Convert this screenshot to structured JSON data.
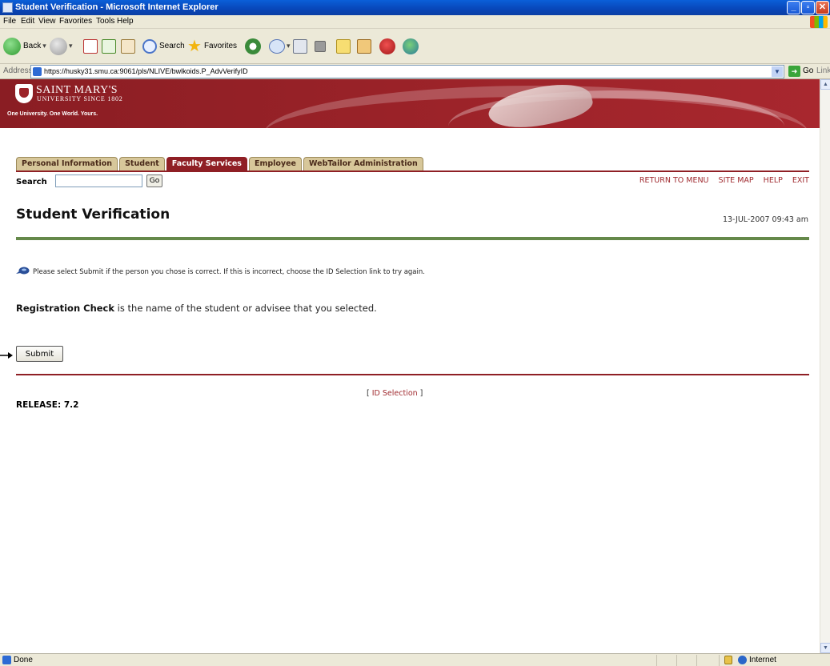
{
  "window": {
    "title": "Student Verification - Microsoft Internet Explorer",
    "min_glyph": "_",
    "max_glyph": "▫",
    "close_glyph": "✕"
  },
  "menu": [
    "File",
    "Edit",
    "View",
    "Favorites",
    "Tools",
    "Help"
  ],
  "toolbar": {
    "back_label": "Back",
    "search_label": "Search",
    "favorites_label": "Favorites"
  },
  "address": {
    "label": "Address",
    "url": "https://husky31.smu.ca:9061/pls/NLIVE/bwlkoids.P_AdvVerifyID",
    "go_label": "Go",
    "links_label": "Links"
  },
  "banner": {
    "university_name": "SAINT MARY'S",
    "university_sub": "UNIVERSITY SINCE 1802",
    "motto": "One University. One World. Yours."
  },
  "tabs": [
    {
      "label": "Personal Information",
      "active": false
    },
    {
      "label": "Student",
      "active": false
    },
    {
      "label": "Faculty Services",
      "active": true
    },
    {
      "label": "Employee",
      "active": false
    },
    {
      "label": "WebTailor Administration",
      "active": false
    }
  ],
  "search": {
    "label": "Search",
    "value": "",
    "go_label": "Go"
  },
  "top_links": [
    "RETURN TO MENU",
    "SITE MAP",
    "HELP",
    "EXIT"
  ],
  "page": {
    "title": "Student Verification",
    "timestamp": "13-JUL-2007 09:43 am",
    "info_message": "Please select Submit if the person you chose is correct. If this is incorrect, choose the ID Selection link to try again.",
    "student_name": "Registration Check",
    "selection_text": " is the name of the student or advisee that you selected.",
    "submit_label": "Submit",
    "bracket_open": "[ ",
    "id_selection_link": "ID Selection",
    "bracket_close": " ]",
    "release": "RELEASE: 7.2"
  },
  "status": {
    "text": "Done",
    "zone": "Internet"
  },
  "colors": {
    "banner_red": "#9c2329",
    "tab_active": "#8f1f25",
    "tab_inactive": "#d7c79a",
    "link_red": "#a02a2f",
    "green_rule": "#65894a"
  }
}
